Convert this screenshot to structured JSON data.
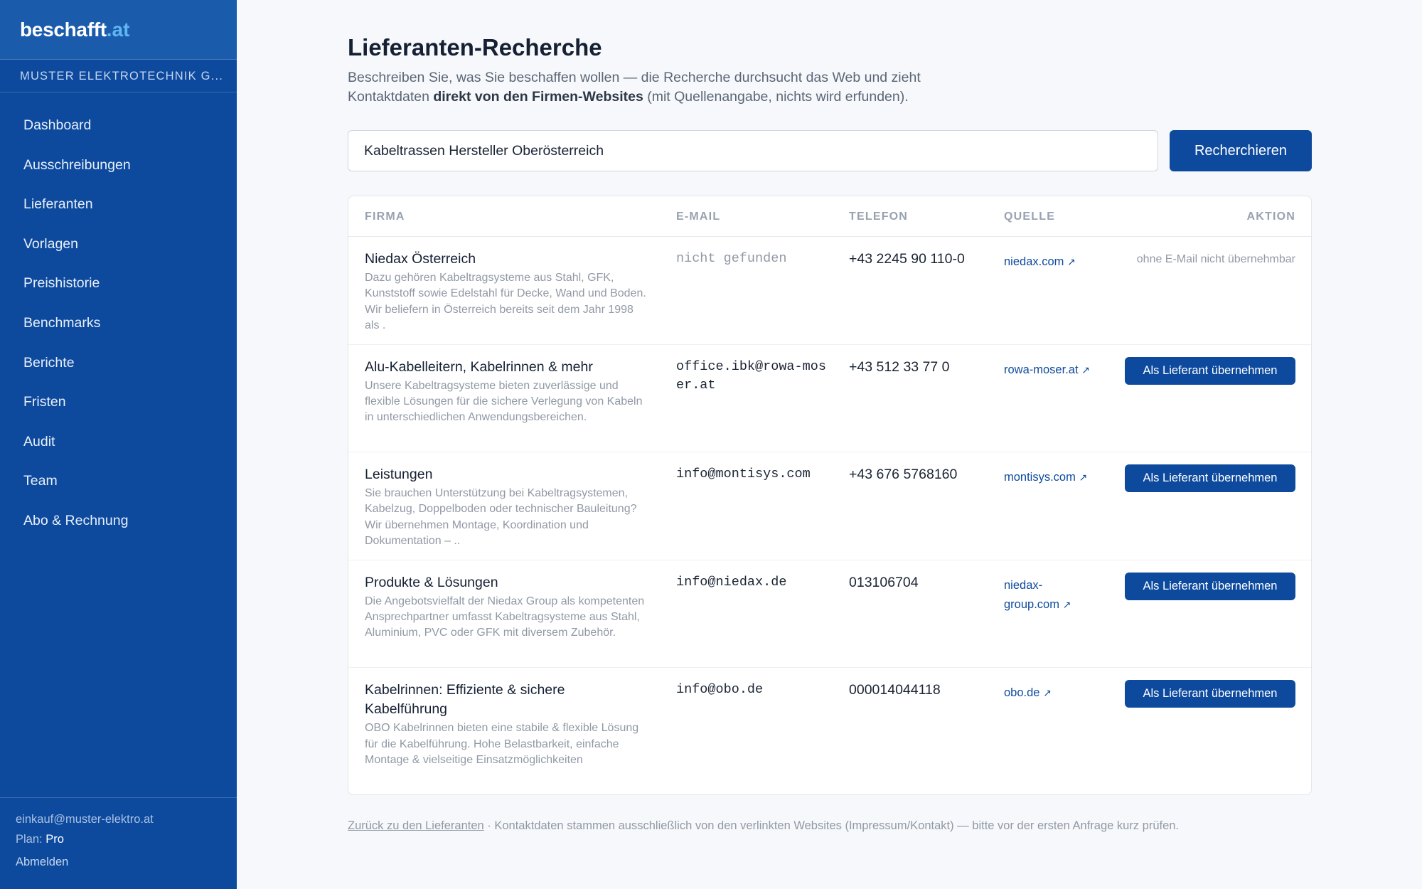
{
  "brand": {
    "name": "beschafft",
    "tld": ".at"
  },
  "organization": "MUSTER ELEKTROTECHNIK G...",
  "nav": [
    {
      "label": "Dashboard"
    },
    {
      "label": "Ausschreibungen"
    },
    {
      "label": "Lieferanten"
    },
    {
      "label": "Vorlagen"
    },
    {
      "label": "Preishistorie"
    },
    {
      "label": "Benchmarks"
    },
    {
      "label": "Berichte"
    },
    {
      "label": "Fristen"
    },
    {
      "label": "Audit"
    },
    {
      "label": "Team"
    },
    {
      "label": "Abo & Rechnung"
    }
  ],
  "account": {
    "email": "einkauf@muster-elektro.at",
    "plan_label": "Plan:",
    "plan_value": "Pro",
    "logout": "Abmelden"
  },
  "page": {
    "title": "Lieferanten-Recherche",
    "intro_1": "Beschreiben Sie, was Sie beschaffen wollen — die Recherche durchsucht das Web und zieht Kontaktdaten ",
    "intro_bold": "direkt von den Firmen-Websites",
    "intro_2": " (mit Quellenangabe, nichts wird erfunden)."
  },
  "search": {
    "value": "Kabeltrassen Hersteller Oberösterreich",
    "button": "Recherchieren"
  },
  "table": {
    "headers": {
      "firm": "FIRMA",
      "email": "E-MAIL",
      "phone": "TELEFON",
      "source": "QUELLE",
      "action": "AKTION"
    },
    "rows": [
      {
        "name": "Niedax Österreich",
        "desc": "Dazu gehören Kabeltragsysteme aus Stahl, GFK, Kunststoff sowie Edelstahl für Decke, Wand und Boden. Wir beliefern in Österreich bereits seit dem Jahr 1998 als .",
        "email": "nicht gefunden",
        "phone": "+43 2245 90 110-0",
        "source": "niedax.com",
        "action": "ohne E-Mail nicht übernehmbar"
      },
      {
        "name": "Alu-Kabelleitern, Kabelrinnen & mehr",
        "desc": "Unsere Kabeltragsysteme bieten zuverlässige und flexible Lösungen für die sichere Verlegung von Kabeln in unterschiedlichen Anwendungsbereichen.",
        "email": "office.ibk@rowa-moser.at",
        "phone": "+43 512 33 77 0",
        "source": "rowa-moser.at",
        "action": "Als Lieferant übernehmen"
      },
      {
        "name": "Leistungen",
        "desc": "Sie brauchen Unterstützung bei Kabeltragsystemen, Kabelzug, Doppelboden oder technischer Bauleitung? Wir übernehmen Montage, Koordination und Dokumentation – ..",
        "email": "info@montisys.com",
        "phone": "+43 676 5768160",
        "source": "montisys.com",
        "action": "Als Lieferant übernehmen"
      },
      {
        "name": "Produkte & Lösungen",
        "desc": "Die Angebotsvielfalt der Niedax Group als kompetenten Ansprechpartner umfasst Kabeltragsysteme aus Stahl, Aluminium, PVC oder GFK mit diversem Zubehör.",
        "email": "info@niedax.de",
        "phone": "013106704",
        "source": "niedax-group.com",
        "action": "Als Lieferant übernehmen"
      },
      {
        "name": "Kabelrinnen: Effiziente & sichere Kabelführung",
        "desc": "OBO Kabelrinnen bieten eine stabile & flexible Lösung für die Kabelführung. Hohe Belastbarkeit, einfache Montage & vielseitige Einsatzmöglichkeiten",
        "email": "info@obo.de",
        "phone": "000014044118",
        "source": "obo.de",
        "action": "Als Lieferant übernehmen"
      }
    ]
  },
  "footer": {
    "back_link": "Zurück zu den Lieferanten",
    "note": " · Kontaktdaten stammen ausschließlich von den verlinkten Websites (Impressum/Kontakt) — bitte vor der ersten Anfrage kurz prüfen."
  },
  "icons": {
    "external_link": "arrow-up-right-icon"
  },
  "colors": {
    "sidebar": "#0d4a9e",
    "accent": "#0d4a9e",
    "brand_tld": "#5fb6f2"
  }
}
